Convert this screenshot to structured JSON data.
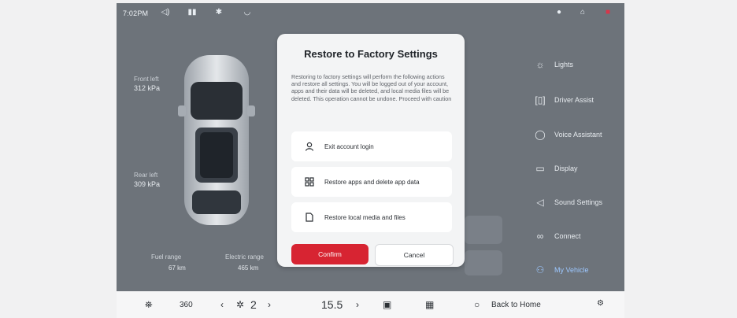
{
  "status": {
    "time": "7:02PM"
  },
  "vehicle": {
    "tire_front_label": "Front left",
    "tire_front_value": "312 kPa",
    "tire_rear_label": "Rear left",
    "tire_rear_value": "309 kPa",
    "range_label_1": "Fuel range",
    "range_value_1": "67 km",
    "range_label_2": "Electric range",
    "range_value_2": "465 km"
  },
  "menu": {
    "items": [
      {
        "label": "Lights",
        "icon": "bulb-icon"
      },
      {
        "label": "Driver Assist",
        "icon": "steering-icon"
      },
      {
        "label": "Voice Assistant",
        "icon": "voice-icon"
      },
      {
        "label": "Display",
        "icon": "display-icon"
      },
      {
        "label": "Sound Settings",
        "icon": "speaker-icon"
      },
      {
        "label": "Connect",
        "icon": "link-icon"
      },
      {
        "label": "My Vehicle",
        "icon": "user-icon",
        "active": true
      }
    ]
  },
  "modal": {
    "title": "Restore to Factory Settings",
    "description": "Restoring to factory settings will perform the following actions and restore all settings. You will be logged out of your account, apps and their data will be deleted, and local media files will be deleted. This operation cannot be undone. Proceed with caution",
    "options": [
      {
        "label": "Exit account login",
        "icon": "person-icon"
      },
      {
        "label": "Restore apps and delete app data",
        "icon": "apps-grid-icon"
      },
      {
        "label": "Restore local media and files",
        "icon": "file-icon"
      }
    ],
    "confirm_label": "Confirm",
    "cancel_label": "Cancel"
  },
  "dock": {
    "fan_speed": "2",
    "temperature": "15.5",
    "back_home_label": "Back to Home",
    "nav_360": "360"
  },
  "colors": {
    "accent_red": "#d72432",
    "active_blue": "#9cc7ff"
  }
}
